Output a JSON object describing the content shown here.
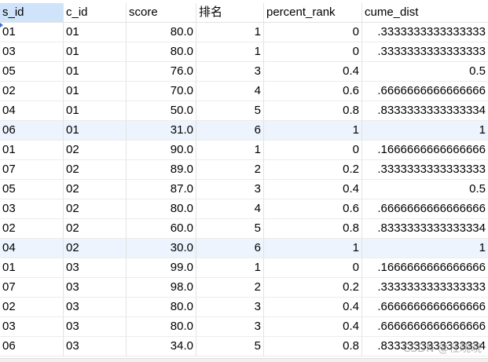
{
  "table": {
    "columns": [
      "s_id",
      "c_id",
      "score",
      "排名",
      "percent_rank",
      "cume_dist"
    ],
    "rows": [
      [
        "01",
        "01",
        "80.0",
        "1",
        "0",
        ".3333333333333333"
      ],
      [
        "03",
        "01",
        "80.0",
        "1",
        "0",
        ".3333333333333333"
      ],
      [
        "05",
        "01",
        "76.0",
        "3",
        "0.4",
        "0.5"
      ],
      [
        "02",
        "01",
        "70.0",
        "4",
        "0.6",
        ".6666666666666666"
      ],
      [
        "04",
        "01",
        "50.0",
        "5",
        "0.8",
        ".8333333333333334"
      ],
      [
        "06",
        "01",
        "31.0",
        "6",
        "1",
        "1"
      ],
      [
        "01",
        "02",
        "90.0",
        "1",
        "0",
        ".1666666666666666"
      ],
      [
        "07",
        "02",
        "89.0",
        "2",
        "0.2",
        ".3333333333333333"
      ],
      [
        "05",
        "02",
        "87.0",
        "3",
        "0.4",
        "0.5"
      ],
      [
        "03",
        "02",
        "80.0",
        "4",
        "0.6",
        ".6666666666666666"
      ],
      [
        "02",
        "02",
        "60.0",
        "5",
        "0.8",
        ".8333333333333334"
      ],
      [
        "04",
        "02",
        "30.0",
        "6",
        "1",
        "1"
      ],
      [
        "01",
        "03",
        "99.0",
        "1",
        "0",
        ".1666666666666666"
      ],
      [
        "07",
        "03",
        "98.0",
        "2",
        "0.2",
        ".3333333333333333"
      ],
      [
        "02",
        "03",
        "80.0",
        "3",
        "0.4",
        ".6666666666666666"
      ],
      [
        "03",
        "03",
        "80.0",
        "3",
        "0.4",
        ".6666666666666666"
      ],
      [
        "06",
        "03",
        "34.0",
        "5",
        "0.8",
        ".8333333333333334"
      ]
    ],
    "highlighted_rows": [
      5,
      11
    ]
  },
  "watermark": "CSDN @杜晓晓"
}
